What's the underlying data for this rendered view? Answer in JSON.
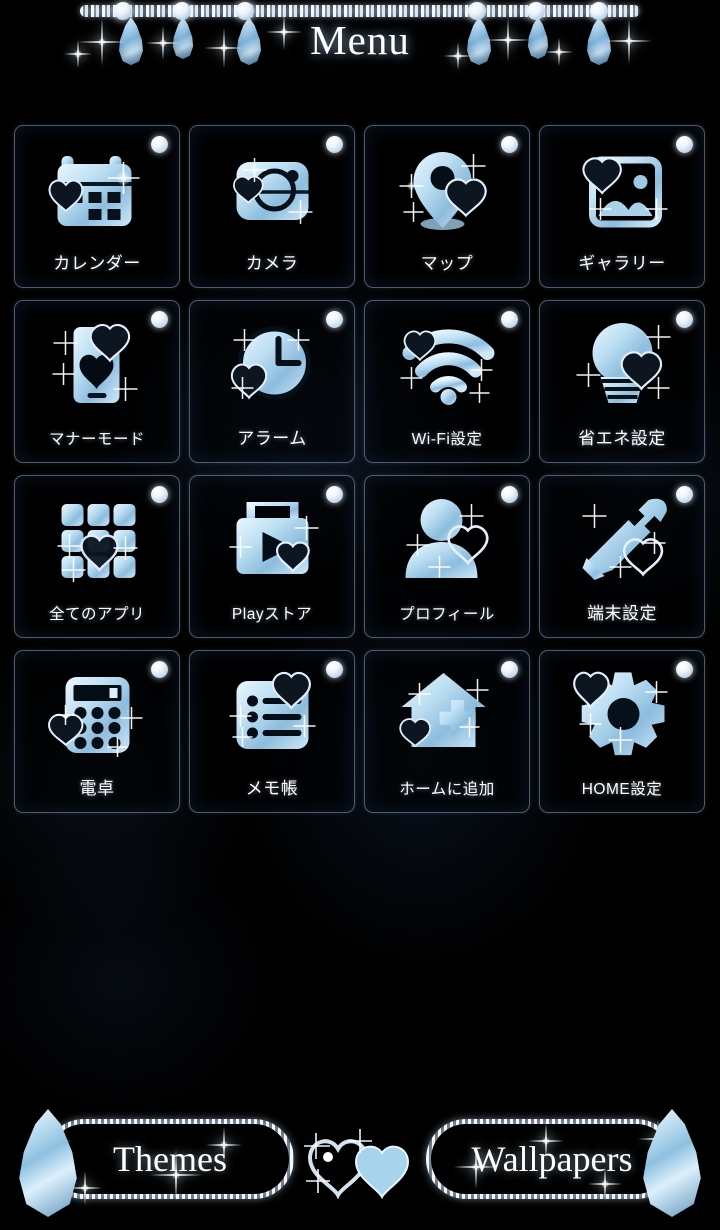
{
  "header": {
    "title": "Menu",
    "decorations": [
      "chain-jewels",
      "teardrop-gem",
      "sparkle-star",
      "pearl"
    ]
  },
  "theme": {
    "background_color": "#000000",
    "accent_color": "#9fcce6",
    "gem_light": "#e8f6ff",
    "gem_mid": "#9ec9e4",
    "gem_dark": "#5d90b8",
    "text_color": "#ffffff",
    "tile_border_color": "#bed7f0"
  },
  "grid": {
    "columns": 4,
    "rows": 4,
    "items": [
      {
        "label": "カレンダー",
        "icon": "calendar-icon",
        "badge": "pearl-badge"
      },
      {
        "label": "カメラ",
        "icon": "camera-icon",
        "badge": "pearl-badge"
      },
      {
        "label": "マップ",
        "icon": "map-pin-icon",
        "badge": "pearl-badge"
      },
      {
        "label": "ギャラリー",
        "icon": "gallery-icon",
        "badge": "pearl-badge"
      },
      {
        "label": "マナーモード",
        "icon": "silent-mode-icon",
        "badge": "pearl-badge"
      },
      {
        "label": "アラーム",
        "icon": "alarm-clock-icon",
        "badge": "pearl-badge"
      },
      {
        "label": "Wi-Fi設定",
        "icon": "wifi-icon",
        "badge": "pearl-badge"
      },
      {
        "label": "省エネ設定",
        "icon": "lightbulb-icon",
        "badge": "pearl-badge"
      },
      {
        "label": "全てのアプリ",
        "icon": "app-drawer-icon",
        "badge": "pearl-badge"
      },
      {
        "label": "Playストア",
        "icon": "play-store-icon",
        "badge": "pearl-badge"
      },
      {
        "label": "プロフィール",
        "icon": "profile-icon",
        "badge": "pearl-badge"
      },
      {
        "label": "端末設定",
        "icon": "wrench-screwdriver-icon",
        "badge": "pearl-badge"
      },
      {
        "label": "電卓",
        "icon": "calculator-icon",
        "badge": "pearl-badge"
      },
      {
        "label": "メモ帳",
        "icon": "notepad-icon",
        "badge": "pearl-badge"
      },
      {
        "label": "ホームに追加",
        "icon": "add-to-home-icon",
        "badge": "pearl-badge"
      },
      {
        "label": "HOME設定",
        "icon": "home-settings-gear-icon",
        "badge": "pearl-badge"
      }
    ]
  },
  "bottom_bar": {
    "themes_label": "Themes",
    "wallpapers_label": "Wallpapers",
    "center_decoration": "heart-gem-icon"
  }
}
